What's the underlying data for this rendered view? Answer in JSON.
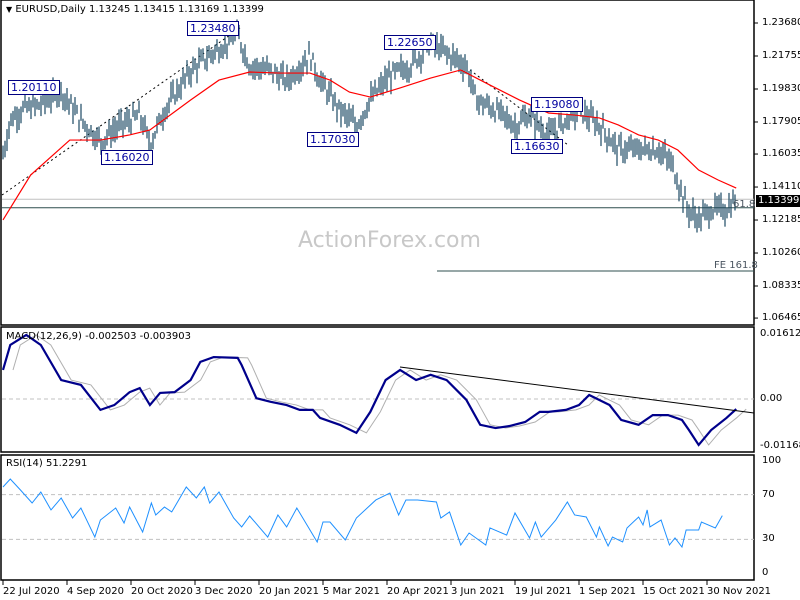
{
  "header": {
    "symbol": "EURUSD,Daily",
    "ohlc": "1.13245 1.13415 1.13169 1.13399"
  },
  "watermark": "ActionForex.com",
  "current_price": "1.13399",
  "colors": {
    "bars": "#1c4a63",
    "ma": "#ff0000",
    "macd": "#00008b",
    "signal": "#b0b0b0",
    "rsi": "#1e90ff",
    "grid": "#c0c0c0"
  },
  "chart_data": [
    {
      "type": "line",
      "title": "EURUSD,Daily",
      "y_ticks": [
        "1.23680",
        "1.21755",
        "1.19830",
        "1.17905",
        "1.16035",
        "1.14110",
        "1.12185",
        "1.10260",
        "1.08335",
        "1.06465"
      ],
      "ylim": [
        1.06465,
        1.2368
      ],
      "x_ticks": [
        "22 Jul 2020",
        "4 Sep 2020",
        "20 Oct 2020",
        "3 Dec 2020",
        "20 Jan 2021",
        "5 Mar 2021",
        "20 Apr 2021",
        "3 Jun 2021",
        "19 Jul 2021",
        "1 Sep 2021",
        "15 Oct 2021",
        "30 Nov 2021"
      ],
      "price_close": [
        [
          "2020-07-22",
          1.16
        ],
        [
          "2020-07-27",
          1.18
        ],
        [
          "2020-08-03",
          1.186
        ],
        [
          "2020-08-17",
          1.189
        ],
        [
          "2020-08-31",
          1.197
        ],
        [
          "2020-09-14",
          1.18
        ],
        [
          "2020-09-28",
          1.168
        ],
        [
          "2020-10-12",
          1.177
        ],
        [
          "2020-10-26",
          1.183
        ],
        [
          "2020-11-02",
          1.166
        ],
        [
          "2020-11-12",
          1.186
        ],
        [
          "2020-11-30",
          1.209
        ],
        [
          "2020-12-14",
          1.218
        ],
        [
          "2021-01-04",
          1.23
        ],
        [
          "2021-01-13",
          1.212
        ],
        [
          "2021-01-28",
          1.209
        ],
        [
          "2021-02-08",
          1.203
        ],
        [
          "2021-02-24",
          1.218
        ],
        [
          "2021-03-03",
          1.203
        ],
        [
          "2021-03-17",
          1.186
        ],
        [
          "2021-03-29",
          1.177
        ],
        [
          "2021-04-08",
          1.192
        ],
        [
          "2021-04-22",
          1.206
        ],
        [
          "2021-05-06",
          1.212
        ],
        [
          "2021-05-20",
          1.225
        ],
        [
          "2021-06-02",
          1.218
        ],
        [
          "2021-06-14",
          1.212
        ],
        [
          "2021-06-21",
          1.192
        ],
        [
          "2021-07-05",
          1.186
        ],
        [
          "2021-07-19",
          1.177
        ],
        [
          "2021-07-29",
          1.183
        ],
        [
          "2021-08-11",
          1.171
        ],
        [
          "2021-08-19",
          1.177
        ],
        [
          "2021-09-01",
          1.186
        ],
        [
          "2021-09-15",
          1.177
        ],
        [
          "2021-09-28",
          1.163
        ],
        [
          "2021-10-12",
          1.163
        ],
        [
          "2021-10-26",
          1.163
        ],
        [
          "2021-11-05",
          1.154
        ],
        [
          "2021-11-16",
          1.128
        ],
        [
          "2021-11-24",
          1.122
        ],
        [
          "2021-12-03",
          1.128
        ],
        [
          "2021-12-14",
          1.128
        ],
        [
          "2021-12-21",
          1.134
        ]
      ],
      "moving_average": [
        [
          "2020-07-22",
          1.1219
        ],
        [
          "2020-08-10",
          1.1481
        ],
        [
          "2020-09-06",
          1.1685
        ],
        [
          "2020-09-28",
          1.1685
        ],
        [
          "2020-10-19",
          1.1715
        ],
        [
          "2020-11-02",
          1.1744
        ],
        [
          "2020-11-30",
          1.1919
        ],
        [
          "2020-12-21",
          1.2035
        ],
        [
          "2021-01-13",
          1.2082
        ],
        [
          "2021-02-03",
          1.2076
        ],
        [
          "2021-02-24",
          1.2076
        ],
        [
          "2021-03-10",
          1.2035
        ],
        [
          "2021-03-24",
          1.1965
        ],
        [
          "2021-04-08",
          1.1936
        ],
        [
          "2021-04-29",
          1.1989
        ],
        [
          "2021-05-20",
          1.2047
        ],
        [
          "2021-06-10",
          1.2094
        ],
        [
          "2021-07-01",
          1.2006
        ],
        [
          "2021-07-22",
          1.1919
        ],
        [
          "2021-08-11",
          1.1843
        ],
        [
          "2021-08-29",
          1.1831
        ],
        [
          "2021-09-15",
          1.1814
        ],
        [
          "2021-09-28",
          1.1773
        ],
        [
          "2021-10-12",
          1.1715
        ],
        [
          "2021-10-26",
          1.1685
        ],
        [
          "2021-11-09",
          1.1627
        ],
        [
          "2021-11-24",
          1.151
        ],
        [
          "2021-12-08",
          1.1452
        ],
        [
          "2021-12-21",
          1.1405
        ]
      ],
      "annotations": [
        "1.20110",
        "1.16020",
        "1.23480",
        "1.17030",
        "1.22650",
        "1.19080",
        "1.16630"
      ],
      "levels": [
        {
          "label": "61.8",
          "value": 1.129
        },
        {
          "label": "FE 161.8",
          "value": 1.0921
        },
        {
          "label": "",
          "value": 1.134
        }
      ]
    },
    {
      "type": "line",
      "title": "MACD(12,26,9) -0.002503 -0.003903",
      "y_ticks": [
        "0.016122",
        "0.00",
        "-0.011681"
      ],
      "ylim": [
        -0.011681,
        0.016122
      ],
      "macd": [
        [
          "2020-07-22",
          0.0072
        ],
        [
          "2020-07-27",
          0.0134
        ],
        [
          "2020-08-07",
          0.0159
        ],
        [
          "2020-08-17",
          0.0134
        ],
        [
          "2020-08-31",
          0.0047
        ],
        [
          "2020-09-14",
          0.0035
        ],
        [
          "2020-09-28",
          -0.0027
        ],
        [
          "2020-10-08",
          -0.0015
        ],
        [
          "2020-10-19",
          0.0017
        ],
        [
          "2020-10-26",
          0.0027
        ],
        [
          "2020-11-02",
          -0.0015
        ],
        [
          "2020-11-09",
          0.0015
        ],
        [
          "2020-11-19",
          0.0017
        ],
        [
          "2020-11-30",
          0.0047
        ],
        [
          "2020-12-07",
          0.0092
        ],
        [
          "2020-12-17",
          0.0104
        ],
        [
          "2021-01-04",
          0.0102
        ],
        [
          "2021-01-07",
          0.0084
        ],
        [
          "2021-01-18",
          0.0002
        ],
        [
          "2021-01-28",
          -0.0007
        ],
        [
          "2021-02-08",
          -0.0015
        ],
        [
          "2021-02-17",
          -0.0027
        ],
        [
          "2021-02-26",
          -0.0027
        ],
        [
          "2021-03-03",
          -0.0047
        ],
        [
          "2021-03-17",
          -0.0064
        ],
        [
          "2021-03-29",
          -0.0084
        ],
        [
          "2021-04-08",
          -0.0032
        ],
        [
          "2021-04-19",
          0.0047
        ],
        [
          "2021-04-29",
          0.0072
        ],
        [
          "2021-05-10",
          0.0047
        ],
        [
          "2021-05-20",
          0.006
        ],
        [
          "2021-05-31",
          0.0047
        ],
        [
          "2021-06-14",
          -0.0002
        ],
        [
          "2021-06-24",
          -0.0064
        ],
        [
          "2021-07-05",
          -0.0072
        ],
        [
          "2021-07-15",
          -0.0067
        ],
        [
          "2021-07-26",
          -0.0057
        ],
        [
          "2021-08-05",
          -0.0032
        ],
        [
          "2021-08-11",
          -0.0032
        ],
        [
          "2021-08-23",
          -0.0027
        ],
        [
          "2021-09-01",
          -0.0015
        ],
        [
          "2021-09-08",
          0.001
        ],
        [
          "2021-09-22",
          -0.0015
        ],
        [
          "2021-09-30",
          -0.0052
        ],
        [
          "2021-10-12",
          -0.0064
        ],
        [
          "2021-10-22",
          -0.004
        ],
        [
          "2021-11-02",
          -0.004
        ],
        [
          "2021-11-12",
          -0.0052
        ],
        [
          "2021-11-17",
          -0.0077
        ],
        [
          "2021-11-24",
          -0.0114
        ],
        [
          "2021-12-03",
          -0.0077
        ],
        [
          "2021-12-14",
          -0.0047
        ],
        [
          "2021-12-21",
          -0.0025
        ]
      ]
    },
    {
      "type": "line",
      "title": "RSI(14) 51.2291",
      "y_ticks": [
        "100",
        "70",
        "30",
        "0"
      ],
      "ylim": [
        0,
        100
      ],
      "levels": [
        70,
        30
      ],
      "rsi": [
        [
          "2020-07-22",
          76.8
        ],
        [
          "2020-07-27",
          83.9
        ],
        [
          "2020-08-03",
          74.1
        ],
        [
          "2020-08-11",
          62.5
        ],
        [
          "2020-08-17",
          72.3
        ],
        [
          "2020-08-24",
          56.3
        ],
        [
          "2020-08-31",
          67.0
        ],
        [
          "2020-09-08",
          49.1
        ],
        [
          "2020-09-14",
          58.0
        ],
        [
          "2020-09-24",
          32.1
        ],
        [
          "2020-09-28",
          47.3
        ],
        [
          "2020-10-09",
          58.0
        ],
        [
          "2020-10-15",
          44.6
        ],
        [
          "2020-10-19",
          58.9
        ],
        [
          "2020-10-28",
          36.6
        ],
        [
          "2020-11-03",
          62.5
        ],
        [
          "2020-11-06",
          51.8
        ],
        [
          "2020-11-12",
          58.9
        ],
        [
          "2020-11-17",
          54.5
        ],
        [
          "2020-11-27",
          76.8
        ],
        [
          "2020-12-04",
          67.0
        ],
        [
          "2020-12-10",
          76.8
        ],
        [
          "2020-12-14",
          62.5
        ],
        [
          "2020-12-21",
          72.3
        ],
        [
          "2021-01-01",
          49.1
        ],
        [
          "2021-01-07",
          41.1
        ],
        [
          "2021-01-13",
          50.9
        ],
        [
          "2021-01-26",
          32.1
        ],
        [
          "2021-02-02",
          51.8
        ],
        [
          "2021-02-08",
          41.1
        ],
        [
          "2021-02-15",
          58.0
        ],
        [
          "2021-03-01",
          27.7
        ],
        [
          "2021-03-05",
          45.5
        ],
        [
          "2021-03-10",
          45.5
        ],
        [
          "2021-03-21",
          29.5
        ],
        [
          "2021-03-29",
          49.1
        ],
        [
          "2021-04-12",
          65.2
        ],
        [
          "2021-04-22",
          71.4
        ],
        [
          "2021-04-28",
          51.8
        ],
        [
          "2021-05-03",
          65.2
        ],
        [
          "2021-05-11",
          65.2
        ],
        [
          "2021-05-24",
          63.4
        ],
        [
          "2021-05-27",
          49.1
        ],
        [
          "2021-06-02",
          54.5
        ],
        [
          "2021-06-10",
          25.0
        ],
        [
          "2021-06-16",
          35.7
        ],
        [
          "2021-06-28",
          25.0
        ],
        [
          "2021-07-01",
          40.2
        ],
        [
          "2021-07-13",
          33.9
        ],
        [
          "2021-07-19",
          53.6
        ],
        [
          "2021-07-29",
          31.3
        ],
        [
          "2021-08-02",
          45.5
        ],
        [
          "2021-08-06",
          32.1
        ],
        [
          "2021-08-16",
          47.3
        ],
        [
          "2021-08-24",
          63.4
        ],
        [
          "2021-08-29",
          51.8
        ],
        [
          "2021-09-06",
          50.0
        ],
        [
          "2021-09-13",
          32.1
        ],
        [
          "2021-09-15",
          41.1
        ],
        [
          "2021-09-21",
          24.1
        ],
        [
          "2021-09-24",
          32.1
        ],
        [
          "2021-10-01",
          27.7
        ],
        [
          "2021-10-04",
          40.2
        ],
        [
          "2021-10-12",
          50.0
        ],
        [
          "2021-10-15",
          42.9
        ],
        [
          "2021-10-18",
          56.3
        ],
        [
          "2021-10-20",
          41.1
        ],
        [
          "2021-10-28",
          47.3
        ],
        [
          "2021-11-03",
          25.0
        ],
        [
          "2021-11-07",
          31.3
        ],
        [
          "2021-11-12",
          23.2
        ],
        [
          "2021-11-15",
          38.4
        ],
        [
          "2021-11-24",
          38.4
        ],
        [
          "2021-11-26",
          45.5
        ],
        [
          "2021-12-06",
          40.2
        ],
        [
          "2021-12-11",
          51.2
        ]
      ]
    }
  ]
}
